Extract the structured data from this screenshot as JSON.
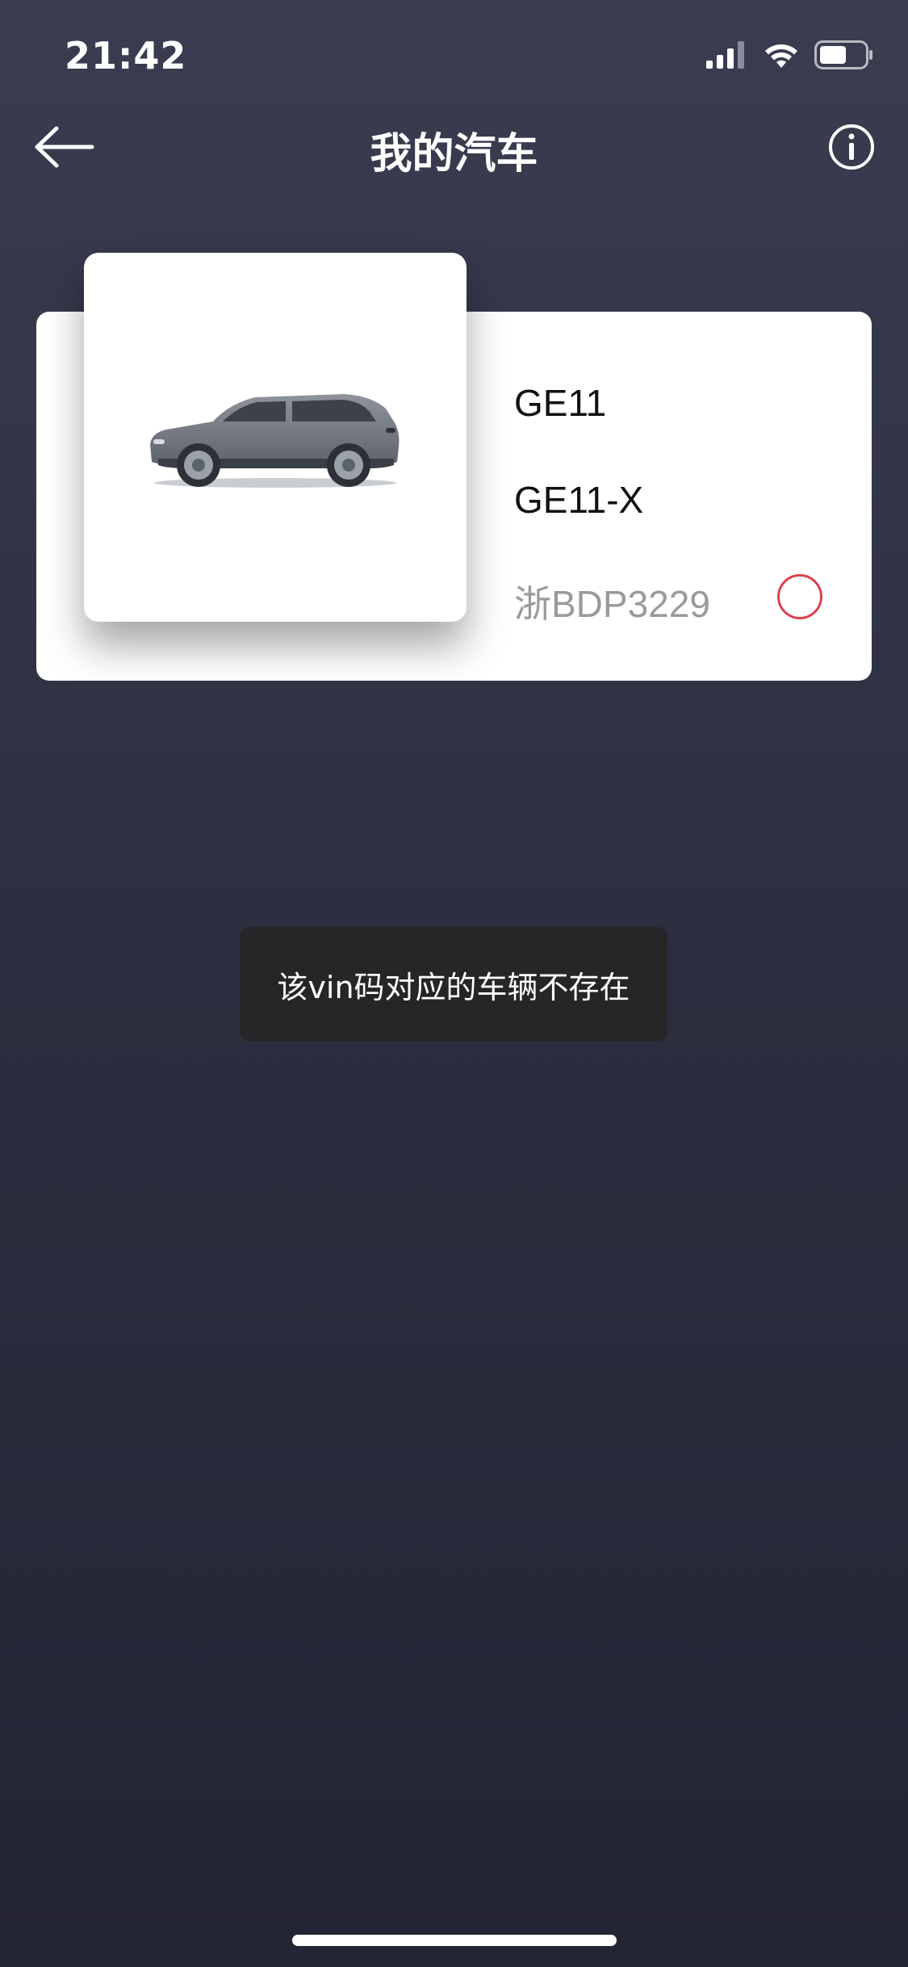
{
  "status_bar": {
    "time": "21:42",
    "icons": [
      "signal-icon",
      "wifi-icon",
      "battery-icon"
    ]
  },
  "nav": {
    "title": "我的汽车",
    "back_icon": "arrow-left-icon",
    "info_icon": "info-icon"
  },
  "car": {
    "model": "GE11",
    "variant": "GE11-X",
    "plate": "浙BDP3229",
    "image_icon": "suv-car-icon",
    "selected": false
  },
  "toast": {
    "message": "该vin码对应的车辆不存在"
  },
  "colors": {
    "background_top": "#3a3d50",
    "background_bottom": "#232434",
    "radio_accent": "#d9434d",
    "toast_bg": "#262628"
  }
}
